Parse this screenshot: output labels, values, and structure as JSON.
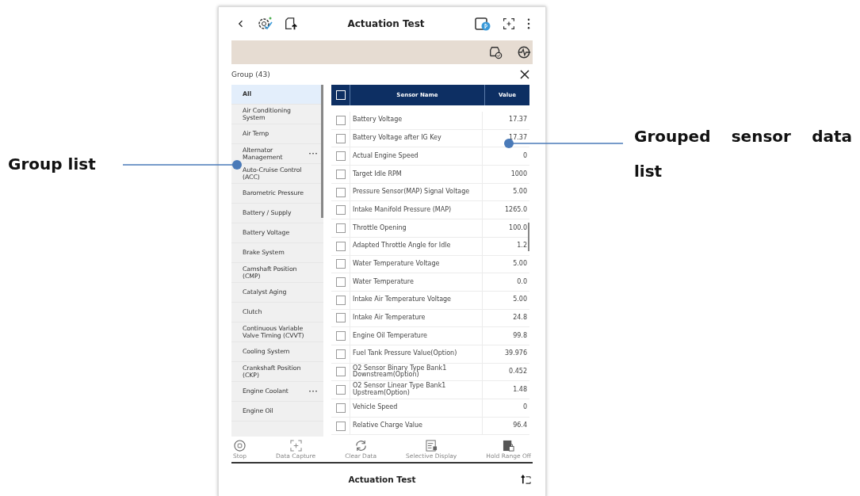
{
  "header": {
    "title": "Actuation Test"
  },
  "group_panel": {
    "title": "Group (43)"
  },
  "groups": [
    {
      "label": "All",
      "selected": true,
      "has_more": false
    },
    {
      "label": "Air Conditioning System",
      "selected": false,
      "has_more": false
    },
    {
      "label": "Air Temp",
      "selected": false,
      "has_more": false
    },
    {
      "label": "Alternator Management",
      "selected": false,
      "has_more": true
    },
    {
      "label": "Auto-Cruise Control (ACC)",
      "selected": false,
      "has_more": false
    },
    {
      "label": "Barometric Pressure",
      "selected": false,
      "has_more": false
    },
    {
      "label": "Battery / Supply",
      "selected": false,
      "has_more": false
    },
    {
      "label": "Battery Voltage",
      "selected": false,
      "has_more": false
    },
    {
      "label": "Brake System",
      "selected": false,
      "has_more": false
    },
    {
      "label": "Camshaft Position (CMP)",
      "selected": false,
      "has_more": false
    },
    {
      "label": "Catalyst Aging",
      "selected": false,
      "has_more": false
    },
    {
      "label": "Clutch",
      "selected": false,
      "has_more": false
    },
    {
      "label": "Continuous Variable Valve Timing (CVVT)",
      "selected": false,
      "has_more": false
    },
    {
      "label": "Cooling System",
      "selected": false,
      "has_more": false
    },
    {
      "label": "Crankshaft Position (CKP)",
      "selected": false,
      "has_more": false
    },
    {
      "label": "Engine Coolant",
      "selected": false,
      "has_more": true
    },
    {
      "label": "Engine Oil",
      "selected": false,
      "has_more": false
    }
  ],
  "table": {
    "columns": [
      "Sensor Name",
      "Value"
    ],
    "select_all_checked": false,
    "rows": [
      {
        "name": "Battery Voltage",
        "value": "17.37",
        "checked": false
      },
      {
        "name": "Battery Voltage after IG Key",
        "value": "17.37",
        "checked": false
      },
      {
        "name": "Actual Engine Speed",
        "value": "0",
        "checked": false
      },
      {
        "name": "Target Idle RPM",
        "value": "1000",
        "checked": false
      },
      {
        "name": "Pressure Sensor(MAP) Signal Voltage",
        "value": "5.00",
        "checked": false
      },
      {
        "name": "Intake Manifold Pressure (MAP)",
        "value": "1265.0",
        "checked": false
      },
      {
        "name": "Throttle Opening",
        "value": "100.0",
        "checked": false
      },
      {
        "name": "Adapted Throttle Angle for Idle",
        "value": "1.2",
        "checked": false
      },
      {
        "name": "Water Temperature Voltage",
        "value": "5.00",
        "checked": false
      },
      {
        "name": "Water Temperature",
        "value": "0.0",
        "checked": false
      },
      {
        "name": "Intake Air Temperature Voltage",
        "value": "5.00",
        "checked": false
      },
      {
        "name": "Intake Air Temperature",
        "value": "24.8",
        "checked": false
      },
      {
        "name": "Engine Oil Temperature",
        "value": "99.8",
        "checked": false
      },
      {
        "name": "Fuel Tank Pressure Value(Option)",
        "value": "39.976",
        "checked": false
      },
      {
        "name": "O2 Sensor Binary Type Bank1 Downstream(Option)",
        "value": "0.452",
        "checked": false
      },
      {
        "name": "O2 Sensor Linear Type Bank1 Upstream(Option)",
        "value": "1.48",
        "checked": false
      },
      {
        "name": "Vehicle Speed",
        "value": "0",
        "checked": false
      },
      {
        "name": "Relative Charge Value",
        "value": "96.4",
        "checked": false
      }
    ]
  },
  "toolbar": [
    "Stop",
    "Data Capture",
    "Clear Data",
    "Selective Display",
    "Hold Range Off"
  ],
  "footer": {
    "title": "Actuation Test"
  },
  "callouts": {
    "group_list": "Group list",
    "sensor_list": "Grouped sensor data list"
  }
}
